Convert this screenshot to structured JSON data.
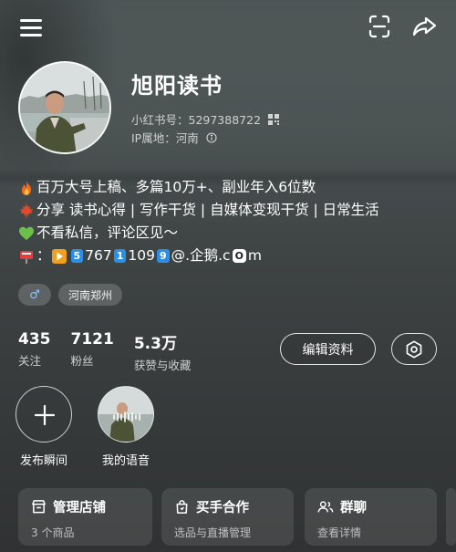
{
  "profile": {
    "name": "旭阳读书",
    "id_label": "小红书号：5297388722",
    "ip_label": "IP属地：河南"
  },
  "bio": {
    "line1": "百万大号上稿、多篇10万+、副业年入6位数",
    "line2": "分享 读书心得 | 写作干货 | 自媒体变现干货 | 日常生活",
    "line3": "不看私信，评论区见～",
    "line4_prefix": "：",
    "line4_d1": "5",
    "line4_t1": "767",
    "line4_d2": "1",
    "line4_t2": "109",
    "line4_d3": "9",
    "line4_t3": "@.企鹅.c",
    "line4_d4": "O",
    "line4_t4": "m"
  },
  "tags": {
    "gender_symbol": "♂",
    "location": "河南郑州"
  },
  "stats": [
    {
      "num": "435",
      "label": "关注"
    },
    {
      "num": "7121",
      "label": "粉丝"
    },
    {
      "num": "5.3万",
      "label": "获赞与收藏"
    }
  ],
  "buttons": {
    "edit_profile": "编辑资料"
  },
  "moments": {
    "publish_label": "发布瞬间",
    "voice_label": "我的语音"
  },
  "cards": [
    {
      "title": "管理店铺",
      "sub": "3 个商品"
    },
    {
      "title": "买手合作",
      "sub": "选品与直播管理"
    },
    {
      "title": "群聊",
      "sub": "查看详情"
    }
  ],
  "colors": {
    "background": "#3b3f40",
    "text": "#ffffff",
    "badge_blue": "#2b8fe6"
  }
}
